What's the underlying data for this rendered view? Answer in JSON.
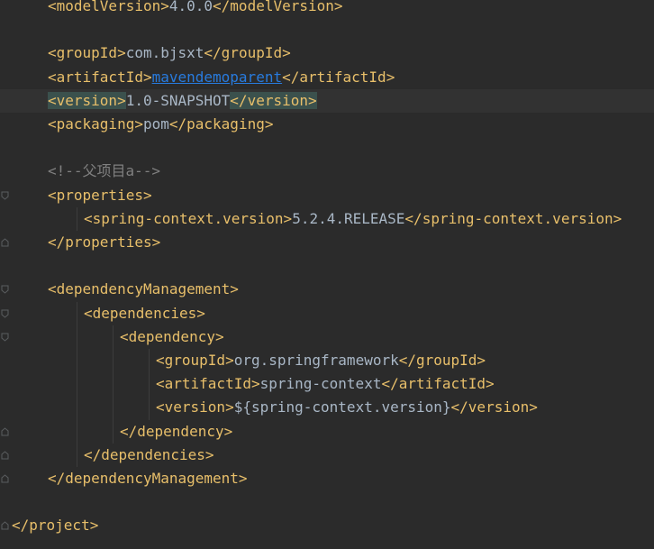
{
  "editor": {
    "lines": [
      {
        "type": "element",
        "open": "<modelVersion>",
        "value": "4.0.0",
        "close": "</modelVersion>"
      },
      {
        "type": "blank"
      },
      {
        "type": "element",
        "open": "<groupId>",
        "value": "com.bjsxt",
        "close": "</groupId>"
      },
      {
        "type": "element",
        "open": "<artifactId>",
        "value": "mavendemoparent",
        "close": "</artifactId>",
        "value_style": "link"
      },
      {
        "type": "element",
        "open": "<version>",
        "value": "1.0-SNAPSHOT",
        "close": "</version>",
        "current": true,
        "highlight_tags": true
      },
      {
        "type": "element",
        "open": "<packaging>",
        "value": "pom",
        "close": "</packaging>"
      },
      {
        "type": "blank"
      },
      {
        "type": "comment",
        "text": "<!--父项目a-->"
      },
      {
        "type": "tag",
        "text": "<properties>",
        "fold": "open"
      },
      {
        "type": "element",
        "open": "<spring-context.version>",
        "value": "5.2.4.RELEASE",
        "close": "</spring-context.version>"
      },
      {
        "type": "tag",
        "text": "</properties>",
        "fold": "close"
      },
      {
        "type": "blank"
      },
      {
        "type": "tag",
        "text": "<dependencyManagement>",
        "fold": "open"
      },
      {
        "type": "tag",
        "text": "<dependencies>",
        "fold": "open"
      },
      {
        "type": "tag",
        "text": "<dependency>",
        "fold": "open"
      },
      {
        "type": "element",
        "open": "<groupId>",
        "value": "org.springframework",
        "close": "</groupId>"
      },
      {
        "type": "element",
        "open": "<artifactId>",
        "value": "spring-context",
        "close": "</artifactId>"
      },
      {
        "type": "element",
        "open": "<version>",
        "value": "${spring-context.version}",
        "close": "</version>"
      },
      {
        "type": "tag",
        "text": "</dependency>",
        "fold": "close"
      },
      {
        "type": "tag",
        "text": "</dependencies>",
        "fold": "close"
      },
      {
        "type": "tag",
        "text": "</dependencyManagement>",
        "fold": "close"
      },
      {
        "type": "blank"
      },
      {
        "type": "tag",
        "text": "</project>",
        "fold": "close"
      }
    ]
  },
  "colors": {
    "background": "#2b2b2b",
    "tag": "#e8bf6a",
    "text": "#a9b7c6",
    "comment": "#808080",
    "link": "#287bde",
    "tag_highlight": "#3b514d",
    "current_line": "#323232"
  }
}
